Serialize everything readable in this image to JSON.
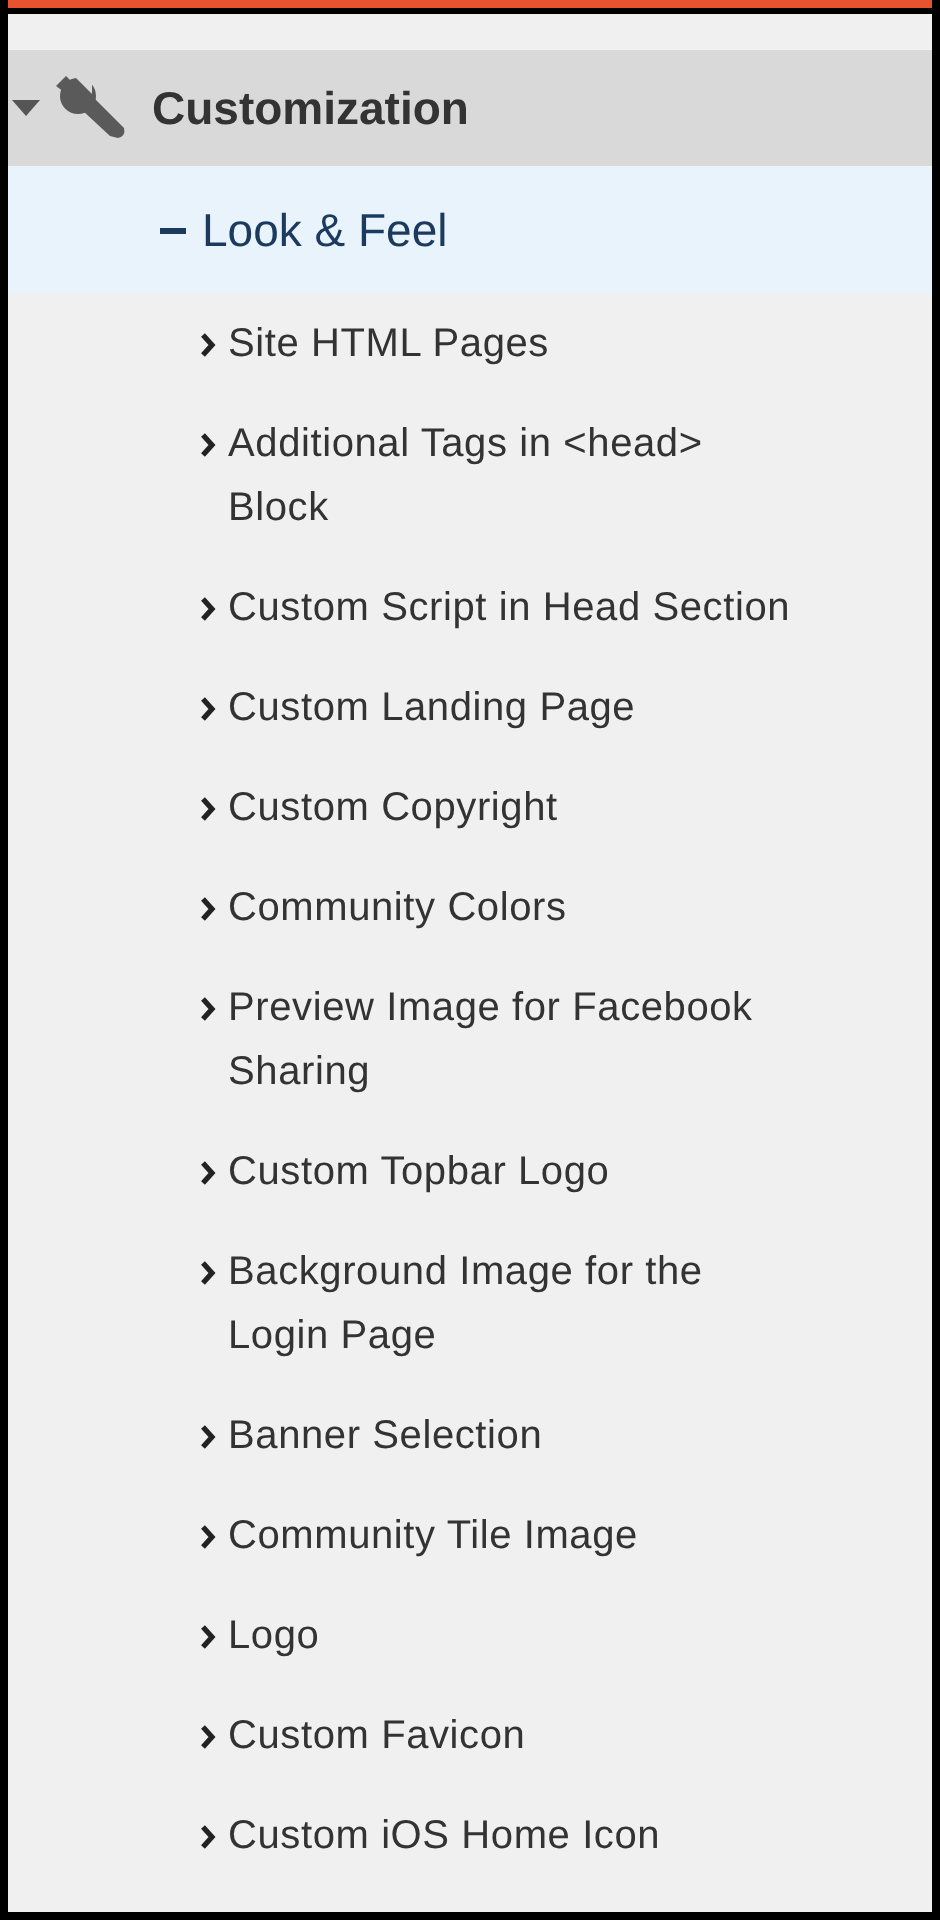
{
  "section": {
    "title": "Customization",
    "expanded": true,
    "children": [
      {
        "label": "Look & Feel",
        "expanded": true,
        "selected": true,
        "children": [
          {
            "label": "Site HTML Pages",
            "expanded": false
          },
          {
            "label": "Additional Tags in <head> Block",
            "expanded": false
          },
          {
            "label": "Custom Script in Head Section",
            "expanded": false
          },
          {
            "label": "Custom Landing Page",
            "expanded": false
          },
          {
            "label": "Custom Copyright",
            "expanded": false
          },
          {
            "label": "Community Colors",
            "expanded": false
          },
          {
            "label": "Preview Image for Facebook Sharing",
            "expanded": false
          },
          {
            "label": "Custom Topbar Logo",
            "expanded": false
          },
          {
            "label": "Background Image for the Login Page",
            "expanded": false
          },
          {
            "label": "Banner Selection",
            "expanded": false
          },
          {
            "label": "Community Tile Image",
            "expanded": false
          },
          {
            "label": "Logo",
            "expanded": false
          },
          {
            "label": "Custom Favicon",
            "expanded": false
          },
          {
            "label": "Custom iOS Home Icon",
            "expanded": false
          }
        ]
      }
    ]
  }
}
